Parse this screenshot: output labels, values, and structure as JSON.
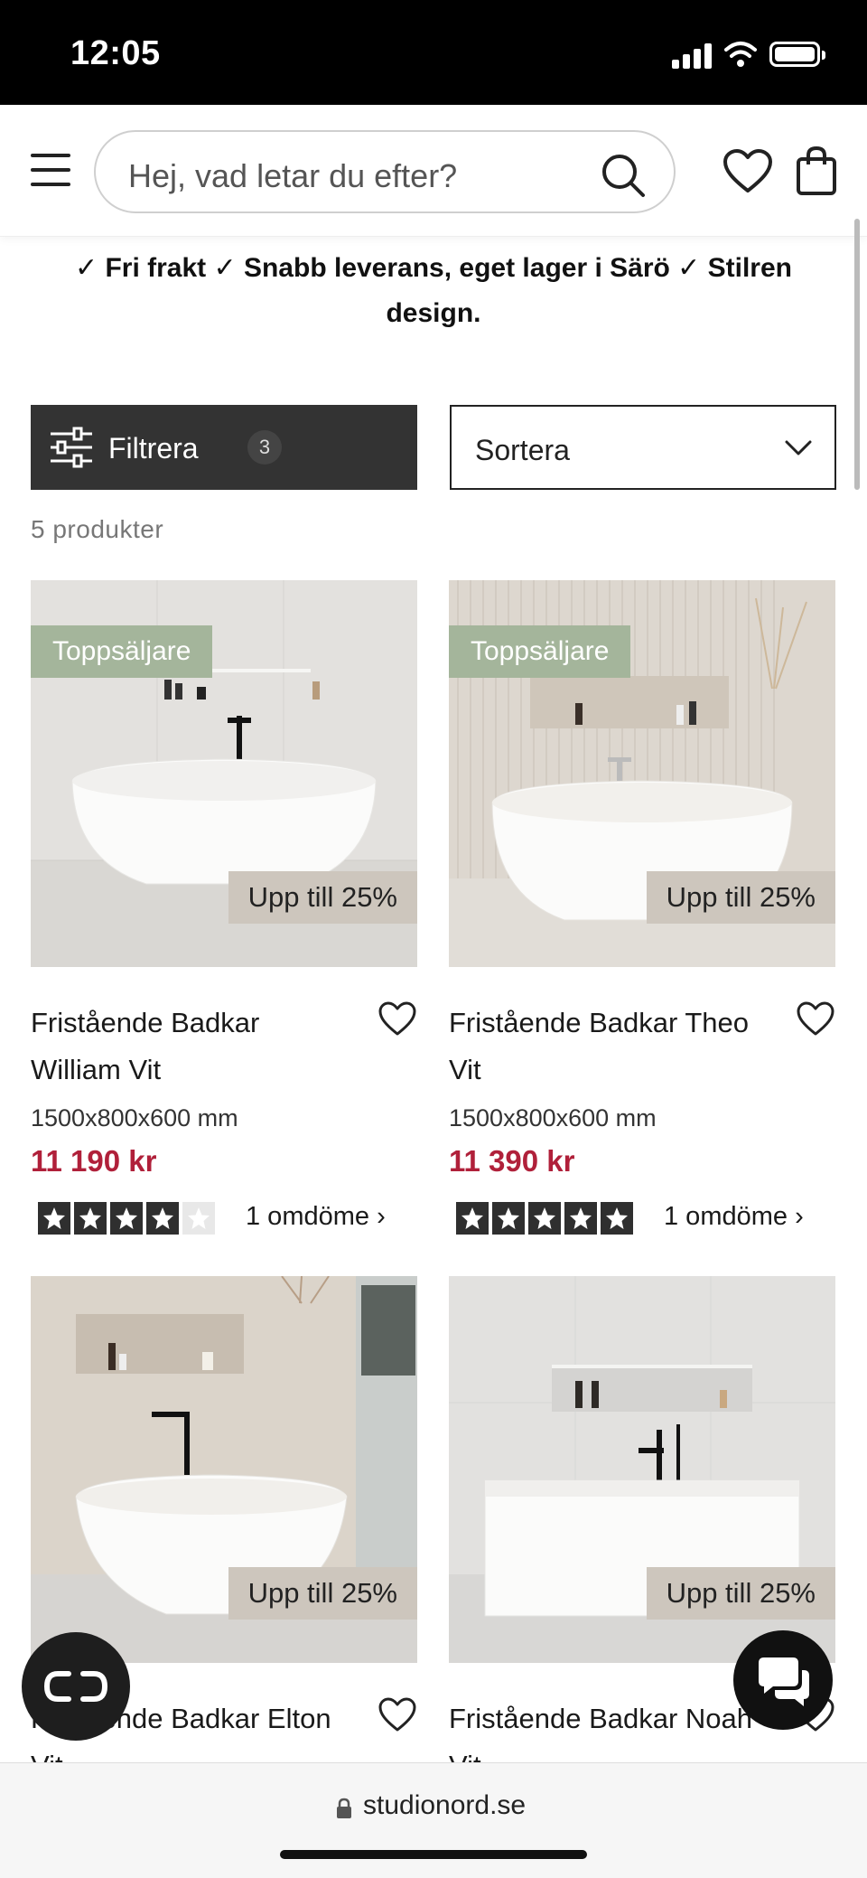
{
  "status": {
    "time": "12:05"
  },
  "header": {
    "search_placeholder": "Hej, vad letar du efter?"
  },
  "usp": {
    "text": "✓ Fri frakt ✓ Snabb leverans, eget lager i Särö ✓ Stilren design."
  },
  "toolbar": {
    "filter_label": "Filtrera",
    "filter_count": "3",
    "sort_label": "Sortera"
  },
  "listing": {
    "count_text": "5 produkter"
  },
  "products": [
    {
      "badge": "Toppsäljare",
      "sale": "Upp till 25%",
      "name": "Fristående Badkar William Vit",
      "dims": "1500x800x600 mm",
      "price": "11 190 kr",
      "rating": 4,
      "reviews": "1 omdöme ›"
    },
    {
      "badge": "Toppsäljare",
      "sale": "Upp till 25%",
      "name": "Fristående Badkar Theo Vit",
      "dims": "1500x800x600 mm",
      "price": "11 390 kr",
      "rating": 5,
      "reviews": "1 omdöme ›"
    },
    {
      "badge": "",
      "sale": "Upp till 25%",
      "name": "Fristående Badkar Elton Vit",
      "dims": "",
      "price": "",
      "rating": 0,
      "reviews": ""
    },
    {
      "badge": "",
      "sale": "Upp till 25%",
      "name": "Fristående Badkar Noah Vit",
      "dims": "",
      "price": "",
      "rating": 0,
      "reviews": ""
    }
  ],
  "urlbar": {
    "url": "studionord.se"
  },
  "colors": {
    "price": "#b0203a",
    "badge_top": "#a4b59b",
    "badge_sale": "#cdc6bd",
    "filter_bg": "#333333"
  }
}
